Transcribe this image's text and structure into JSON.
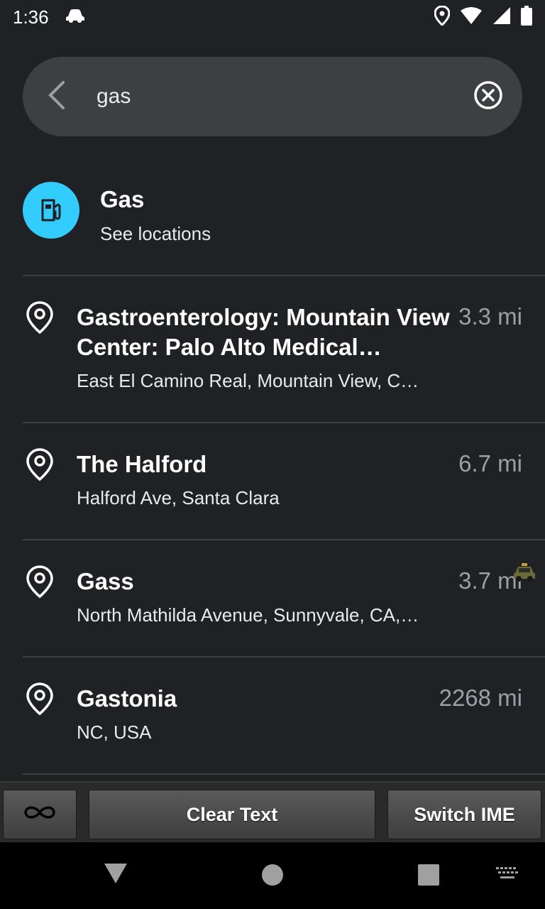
{
  "status_bar": {
    "time": "1:36"
  },
  "search": {
    "query": "gas"
  },
  "category": {
    "title": "Gas",
    "subtitle": "See locations"
  },
  "results": [
    {
      "title": "Gastroenterology: Mountain View Center: Palo Alto Medical…",
      "address": "East El Camino Real, Mountain View, C…",
      "distance": "3.3 mi"
    },
    {
      "title": "The Halford",
      "address": "Halford Ave, Santa Clara",
      "distance": "6.7 mi"
    },
    {
      "title": "Gass",
      "address": "North Mathilda Avenue, Sunnyvale, CA,…",
      "distance": "3.7 mi"
    },
    {
      "title": "Gastonia",
      "address": "NC, USA",
      "distance": "2268 mi"
    }
  ],
  "ime": {
    "clear_label": "Clear Text",
    "switch_label": "Switch IME"
  },
  "colors": {
    "background": "#202124",
    "search_bg": "#3c4043",
    "accent": "#33ccff"
  }
}
